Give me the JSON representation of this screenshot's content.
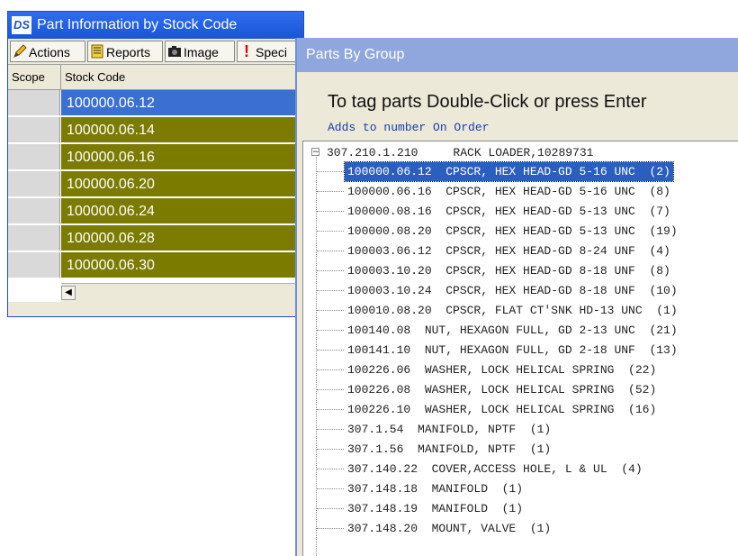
{
  "window_main": {
    "title": "Part Information by Stock Code",
    "logo_text": "DS",
    "toolbar": {
      "actions_label": "Actions",
      "reports_label": "Reports",
      "image_label": "Image",
      "special_label": "Speci"
    },
    "grid": {
      "col_scope": "Scope",
      "col_stock": "Stock Code",
      "rows": [
        {
          "code": "100000.06.12",
          "selected": true
        },
        {
          "code": "100000.06.14"
        },
        {
          "code": "100000.06.16"
        },
        {
          "code": "100000.06.20"
        },
        {
          "code": "100000.06.24"
        },
        {
          "code": "100000.06.28"
        },
        {
          "code": "100000.06.30"
        }
      ]
    }
  },
  "window_group": {
    "title": "Parts By Group",
    "instruction": "To tag parts Double-Click or press Enter",
    "subtitle": "Adds to number On Order",
    "root": {
      "expander": "−",
      "label": "307.210.1.210     RACK LOADER,10289731"
    },
    "items": [
      {
        "text": "100000.06.12  CPSCR, HEX HEAD-GD 5-16 UNC  (2)",
        "selected": true
      },
      {
        "text": "100000.06.16  CPSCR, HEX HEAD-GD 5-16 UNC  (8)"
      },
      {
        "text": "100000.08.16  CPSCR, HEX HEAD-GD 5-13 UNC  (7)"
      },
      {
        "text": "100000.08.20  CPSCR, HEX HEAD-GD 5-13 UNC  (19)"
      },
      {
        "text": "100003.06.12  CPSCR, HEX HEAD-GD 8-24 UNF  (4)"
      },
      {
        "text": "100003.10.20  CPSCR, HEX HEAD-GD 8-18 UNF  (8)"
      },
      {
        "text": "100003.10.24  CPSCR, HEX HEAD-GD 8-18 UNF  (10)"
      },
      {
        "text": "100010.08.20  CPSCR, FLAT CT'SNK HD-13 UNC  (1)"
      },
      {
        "text": "100140.08  NUT, HEXAGON FULL, GD 2-13 UNC  (21)"
      },
      {
        "text": "100141.10  NUT, HEXAGON FULL, GD 2-18 UNF  (13)"
      },
      {
        "text": "100226.06  WASHER, LOCK HELICAL SPRING  (22)"
      },
      {
        "text": "100226.08  WASHER, LOCK HELICAL SPRING  (52)"
      },
      {
        "text": "100226.10  WASHER, LOCK HELICAL SPRING  (16)"
      },
      {
        "text": "307.1.54  MANIFOLD, NPTF  (1)"
      },
      {
        "text": "307.1.56  MANIFOLD, NPTF  (1)"
      },
      {
        "text": "307.140.22  COVER,ACCESS HOLE, L & UL  (4)"
      },
      {
        "text": "307.148.18  MANIFOLD  (1)"
      },
      {
        "text": "307.148.19  MANIFOLD  (1)"
      },
      {
        "text": "307.148.20  MOUNT, VALVE  (1)"
      }
    ]
  },
  "colors": {
    "title_bar": "#1a55d6",
    "group_title_bar": "#8fa7dc",
    "row_olive": "#7b7b00",
    "row_selected": "#3b6fd1",
    "tree_selected": "#2a5fbf"
  }
}
